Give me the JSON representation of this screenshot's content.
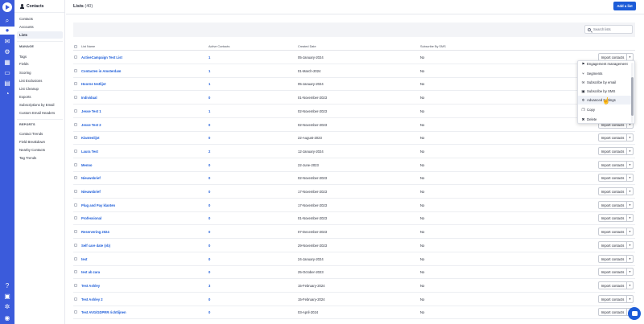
{
  "rail": {
    "icons": [
      "home-icon",
      "search-icon",
      "contacts-icon",
      "campaigns-icon",
      "automations-icon",
      "deals-icon",
      "forms-icon",
      "site-icon",
      "conversations-icon",
      "reports-icon",
      "help-icon",
      "apps-icon",
      "settings-icon",
      "user-avatar-icon"
    ]
  },
  "sidebar": {
    "title": "Contacts",
    "items_top": [
      "Contacts",
      "Accounts",
      "Lists"
    ],
    "manage_heading": "MANAGE",
    "manage_items": [
      "Tags",
      "Fields",
      "Scoring",
      "List Exclusions",
      "List Cleanup",
      "Exports",
      "Subscriptions by Email",
      "Custom Email Headers"
    ],
    "reports_heading": "REPORTS",
    "reports_items": [
      "Contact Trends",
      "Field Breakdown",
      "Nearby Contacts",
      "Tag Trends"
    ]
  },
  "header": {
    "title": "Lists",
    "count": "(40)",
    "add_button": "Add a list"
  },
  "search": {
    "placeholder": "Search lists"
  },
  "table": {
    "columns": [
      "List Name",
      "Active Contacts",
      "Created Date",
      "Subscribe By SMS"
    ],
    "action_label": "Import contacts",
    "rows": [
      {
        "name": "ActiveCampaign Test List",
        "contacts": "1",
        "date": "05-January-2024",
        "sms": "No"
      },
      {
        "name": "Contacten in Amsterdam",
        "contacts": "1",
        "date": "01-March-2024",
        "sms": "No"
      },
      {
        "name": "Hoorne testlijst",
        "contacts": "1",
        "date": "05-January-2024",
        "sms": "No"
      },
      {
        "name": "Individual",
        "contacts": "0",
        "date": "01-November-2023",
        "sms": "No"
      },
      {
        "name": "Jesse Test 1",
        "contacts": "1",
        "date": "02-November-2023",
        "sms": "No"
      },
      {
        "name": "Jesse Test 2",
        "contacts": "0",
        "date": "02-November-2023",
        "sms": "No"
      },
      {
        "name": "Klantenlijst",
        "contacts": "0",
        "date": "22-August-2023",
        "sms": "No"
      },
      {
        "name": "Laura Test",
        "contacts": "2",
        "date": "12-January-2024",
        "sms": "No"
      },
      {
        "name": "Menno",
        "contacts": "0",
        "date": "22-June-2023",
        "sms": "No"
      },
      {
        "name": "Nieuwsbrief",
        "contacts": "0",
        "date": "02-November-2023",
        "sms": "No"
      },
      {
        "name": "Nieuwsbrief",
        "contacts": "0",
        "date": "17-November-2023",
        "sms": "No"
      },
      {
        "name": "Plug and Pay klanten",
        "contacts": "0",
        "date": "17-November-2023",
        "sms": "No"
      },
      {
        "name": "Professional",
        "contacts": "0",
        "date": "01-November-2023",
        "sms": "No"
      },
      {
        "name": "Reservering 2024",
        "contacts": "0",
        "date": "07-December-2023",
        "sms": "No"
      },
      {
        "name": "Self care date (vb)",
        "contacts": "0",
        "date": "29-November-2023",
        "sms": "No"
      },
      {
        "name": "test",
        "contacts": "0",
        "date": "24-January-2024",
        "sms": "No"
      },
      {
        "name": "test ab zara",
        "contacts": "0",
        "date": "25-October-2023",
        "sms": "No"
      },
      {
        "name": "Test Ashley",
        "contacts": "3",
        "date": "15-February-2024",
        "sms": "No"
      },
      {
        "name": "Test Ashley 2",
        "contacts": "0",
        "date": "15-February-2024",
        "sms": "No"
      },
      {
        "name": "Test AVG/GDPRR richtlijnen",
        "contacts": "0",
        "date": "03-April-2024",
        "sms": "No"
      }
    ]
  },
  "dropdown": {
    "items": [
      {
        "label": "Engagement management",
        "icon": "engagement-icon"
      },
      {
        "label": "Segments",
        "icon": "segments-icon"
      },
      {
        "label": "Subscribe by email",
        "icon": "email-icon"
      },
      {
        "label": "Subscribe by SMS",
        "icon": "sms-icon"
      },
      {
        "label": "Advanced Settings",
        "icon": "gear-icon"
      },
      {
        "label": "Copy",
        "icon": "copy-icon"
      },
      {
        "label": "Delete",
        "icon": "delete-icon"
      }
    ],
    "hovered": "Advanced Settings"
  },
  "colors": {
    "rail": "#3b5bdb",
    "accent": "#1c5cd8"
  }
}
